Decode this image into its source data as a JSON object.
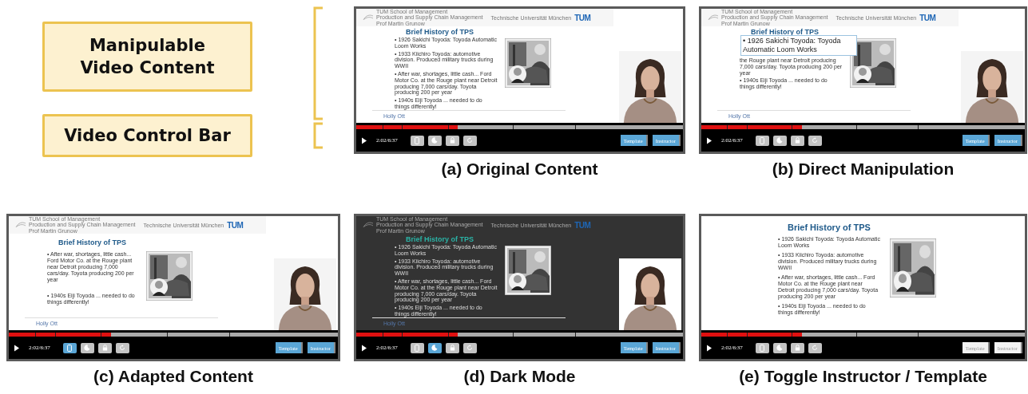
{
  "legend": {
    "items": [
      {
        "lines": [
          "Manipulable",
          "Video Content"
        ]
      },
      {
        "lines": [
          "Video Control Bar"
        ]
      }
    ]
  },
  "panels": [
    {
      "caption": "(a) Original Content",
      "kind": "original",
      "dark_mode": false,
      "header": {
        "lines": [
          "TUM School of Management",
          "Production and Supply Chain Management",
          "Prof Martin Grunow"
        ],
        "university": "Technische Universität München",
        "logo": "TUM"
      },
      "title": "Brief History of TPS",
      "bullets": [
        "• 1926 Sakichi Toyoda: Toyoda Automatic Loom Works",
        "• 1933 Kiichiro Toyoda: automotive division. Produced military trucks during WWII",
        "• After war, shortages, little cash... Ford Motor Co. at the Rouge plant near Detroit producing 7,000 cars/day. Toyota producing 200 per year",
        "• 1940s Eiji Toyoda ... needed to do things differently!"
      ],
      "footer": "Holly Ott",
      "instructor": true,
      "controls": {
        "time": "2:02/6:37",
        "level": 0.31,
        "tools": [
          {
            "kind": "mobile",
            "selected": false
          },
          {
            "kind": "dark",
            "selected": false
          },
          {
            "kind": "lock",
            "selected": false
          },
          {
            "kind": "reset",
            "selected": false
          }
        ],
        "toggles": [
          {
            "label": "Template",
            "on": true
          },
          {
            "label": "Instructor",
            "on": true
          }
        ]
      }
    },
    {
      "caption": "(b) Direct Manipulation",
      "kind": "original",
      "dark_mode": false,
      "header": {
        "lines": [
          "TUM School of Management",
          "Production and Supply Chain Management",
          "Prof Martin Grunow"
        ],
        "university": "Technische Universität München",
        "logo": "TUM"
      },
      "title": "Brief History of TPS",
      "popup": "• 1926 Sakichi Toyoda: Toyoda Automatic Loom Works",
      "bullets": [
        "the Rouge plant near Detroit producing 7,000 cars/day. Toyota producing 200 per year",
        "• 1940s Eiji Toyoda ... needed to do things differently!"
      ],
      "footer": "Holly Ott",
      "instructor": true,
      "controls": {
        "time": "2:02/6:37",
        "level": 0.31,
        "tools": [
          {
            "kind": "mobile",
            "selected": false
          },
          {
            "kind": "dark",
            "selected": false
          },
          {
            "kind": "lock",
            "selected": false
          },
          {
            "kind": "reset",
            "selected": false
          }
        ],
        "toggles": [
          {
            "label": "Template",
            "on": true
          },
          {
            "label": "Instructor",
            "on": true
          }
        ]
      }
    },
    {
      "caption": "(c) Adapted Content",
      "kind": "adapted",
      "dark_mode": false,
      "header": {
        "lines": [
          "TUM School of Management",
          "Production and Supply Chain Management",
          "Prof Martin Grunow"
        ],
        "university": "Technische Universität München",
        "logo": "TUM"
      },
      "title": "Brief History of TPS",
      "bullets": [
        "• After war, shortages, little cash... Ford Motor Co. at the Rouge plant near Detroit producing 7,000 cars/day. Toyota producing 200 per year",
        "• 1940s Eiji Toyoda ... needed to do things differently!"
      ],
      "footer": "Holly Ott",
      "instructor": true,
      "controls": {
        "time": "2:02/6:37",
        "level": 0.31,
        "tools": [
          {
            "kind": "mobile",
            "selected": true
          },
          {
            "kind": "dark",
            "selected": false
          },
          {
            "kind": "lock",
            "selected": false
          },
          {
            "kind": "reset",
            "selected": false
          }
        ],
        "toggles": [
          {
            "label": "Template",
            "on": true
          },
          {
            "label": "Instructor",
            "on": true
          }
        ]
      }
    },
    {
      "caption": "(d) Dark Mode",
      "kind": "original",
      "dark_mode": true,
      "header": {
        "lines": [
          "TUM School of Management",
          "Production and Supply Chain Management",
          "Prof Martin Grunow"
        ],
        "university": "Technische Universität München",
        "logo": "TUM"
      },
      "title": "Brief History of TPS",
      "bullets": [
        "• 1926 Sakichi Toyoda: Toyoda Automatic Loom Works",
        "• 1933 Kiichiro Toyoda: automotive division. Produced military trucks during WWII",
        "• After war, shortages, little cash... Ford Motor Co. at the Rouge plant near Detroit producing 7,000 cars/day. Toyota producing 200 per year",
        "• 1940s Eiji Toyoda ... needed to do things differently!"
      ],
      "footer": "Holly Ott",
      "instructor": true,
      "controls": {
        "time": "2:02/6:37",
        "level": 0.31,
        "tools": [
          {
            "kind": "mobile",
            "selected": false
          },
          {
            "kind": "dark",
            "selected": true
          },
          {
            "kind": "lock",
            "selected": false
          },
          {
            "kind": "reset",
            "selected": false
          }
        ],
        "toggles": [
          {
            "label": "Template",
            "on": true
          },
          {
            "label": "Instructor",
            "on": true
          }
        ]
      }
    },
    {
      "caption": "(e) Toggle Instructor / Template",
      "kind": "template",
      "dark_mode": false,
      "title": "Brief History of TPS",
      "bullets": [
        "• 1926 Sakichi Toyoda: Toyoda Automatic Loom Works",
        "• 1933 Kiichiro Toyoda: automotive division. Produced military trucks during WWII",
        "• After war, shortages, little cash... Ford Motor Co. at the Rouge plant near Detroit producing 7,000 cars/day. Toyota producing 200 per year",
        "• 1940s Eiji Toyoda ... needed to do things differently!"
      ],
      "instructor": false,
      "controls": {
        "time": "2:02/6:37",
        "level": 0.31,
        "tools": [
          {
            "kind": "mobile",
            "selected": false
          },
          {
            "kind": "dark",
            "selected": false
          },
          {
            "kind": "lock",
            "selected": false
          },
          {
            "kind": "reset",
            "selected": false
          }
        ],
        "toggles": [
          {
            "label": "Template",
            "on": false
          },
          {
            "label": "Instructor",
            "on": false
          }
        ]
      }
    }
  ]
}
